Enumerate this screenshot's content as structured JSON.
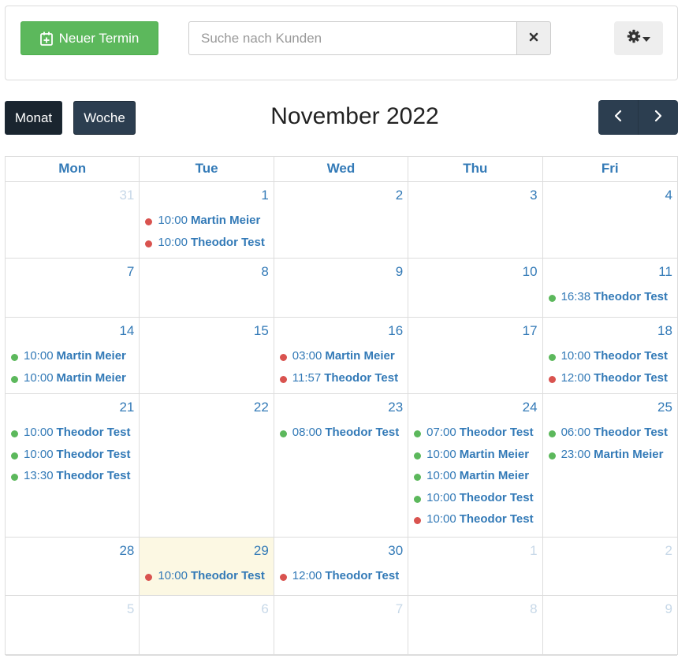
{
  "toolbar": {
    "new_button_label": "Neuer Termin",
    "search_placeholder": "Suche nach Kunden",
    "search_value": ""
  },
  "header": {
    "view_month": "Monat",
    "view_week": "Woche",
    "title": "November 2022"
  },
  "colors": {
    "green": "#5cb85c",
    "red": "#d9534f",
    "link": "#337ab7",
    "today": "#fcf8e3"
  },
  "weekdays": [
    "Mon",
    "Tue",
    "Wed",
    "Thu",
    "Fri"
  ],
  "weeks": [
    {
      "days": [
        {
          "num": "31",
          "other": true,
          "events": []
        },
        {
          "num": "1",
          "events": [
            {
              "time": "10:00",
              "name": "Martin Meier",
              "status": "red"
            },
            {
              "time": "10:00",
              "name": "Theodor Test",
              "status": "red"
            }
          ]
        },
        {
          "num": "2",
          "events": []
        },
        {
          "num": "3",
          "events": []
        },
        {
          "num": "4",
          "events": []
        }
      ]
    },
    {
      "days": [
        {
          "num": "7",
          "events": []
        },
        {
          "num": "8",
          "events": []
        },
        {
          "num": "9",
          "events": []
        },
        {
          "num": "10",
          "events": []
        },
        {
          "num": "11",
          "events": [
            {
              "time": "16:38",
              "name": "Theodor Test",
              "status": "green"
            }
          ]
        }
      ]
    },
    {
      "days": [
        {
          "num": "14",
          "events": [
            {
              "time": "10:00",
              "name": "Martin Meier",
              "status": "green"
            },
            {
              "time": "10:00",
              "name": "Martin Meier",
              "status": "green"
            }
          ]
        },
        {
          "num": "15",
          "events": []
        },
        {
          "num": "16",
          "events": [
            {
              "time": "03:00",
              "name": "Martin Meier",
              "status": "red"
            },
            {
              "time": "11:57",
              "name": "Theodor Test",
              "status": "red"
            }
          ]
        },
        {
          "num": "17",
          "events": []
        },
        {
          "num": "18",
          "events": [
            {
              "time": "10:00",
              "name": "Theodor Test",
              "status": "green"
            },
            {
              "time": "12:00",
              "name": "Theodor Test",
              "status": "red"
            }
          ]
        }
      ]
    },
    {
      "days": [
        {
          "num": "21",
          "events": [
            {
              "time": "10:00",
              "name": "Theodor Test",
              "status": "green"
            },
            {
              "time": "10:00",
              "name": "Theodor Test",
              "status": "green"
            },
            {
              "time": "13:30",
              "name": "Theodor Test",
              "status": "green"
            }
          ]
        },
        {
          "num": "22",
          "events": []
        },
        {
          "num": "23",
          "events": [
            {
              "time": "08:00",
              "name": "Theodor Test",
              "status": "green"
            }
          ]
        },
        {
          "num": "24",
          "events": [
            {
              "time": "07:00",
              "name": "Theodor Test",
              "status": "green"
            },
            {
              "time": "10:00",
              "name": "Martin Meier",
              "status": "green"
            },
            {
              "time": "10:00",
              "name": "Martin Meier",
              "status": "green"
            },
            {
              "time": "10:00",
              "name": "Theodor Test",
              "status": "green"
            },
            {
              "time": "10:00",
              "name": "Theodor Test",
              "status": "red"
            }
          ]
        },
        {
          "num": "25",
          "events": [
            {
              "time": "06:00",
              "name": "Theodor Test",
              "status": "green"
            },
            {
              "time": "23:00",
              "name": "Martin Meier",
              "status": "green"
            }
          ]
        }
      ]
    },
    {
      "days": [
        {
          "num": "28",
          "events": []
        },
        {
          "num": "29",
          "today": true,
          "events": [
            {
              "time": "10:00",
              "name": "Theodor Test",
              "status": "red"
            }
          ]
        },
        {
          "num": "30",
          "events": [
            {
              "time": "12:00",
              "name": "Theodor Test",
              "status": "red"
            }
          ]
        },
        {
          "num": "1",
          "other": true,
          "events": []
        },
        {
          "num": "2",
          "other": true,
          "events": []
        }
      ]
    },
    {
      "days": [
        {
          "num": "5",
          "other": true,
          "events": []
        },
        {
          "num": "6",
          "other": true,
          "events": []
        },
        {
          "num": "7",
          "other": true,
          "events": []
        },
        {
          "num": "8",
          "other": true,
          "events": []
        },
        {
          "num": "9",
          "other": true,
          "events": []
        }
      ]
    }
  ]
}
